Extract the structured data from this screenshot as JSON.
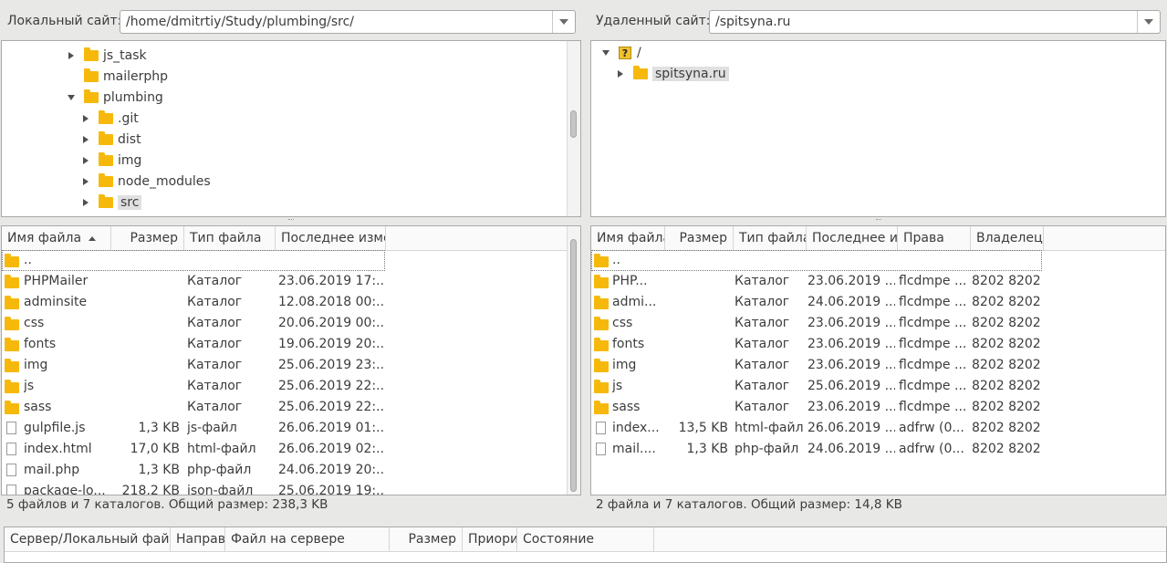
{
  "local_site": {
    "label": "Локальный сайт:",
    "path": "/home/dmitrtiy/Study/plumbing/src/"
  },
  "remote_site": {
    "label": "Удаленный сайт:",
    "path": "/spitsyna.ru"
  },
  "local_tree": [
    {
      "name": "js_task",
      "depth": 0,
      "expander": "collapsed"
    },
    {
      "name": "mailerphp",
      "depth": 0,
      "expander": "none"
    },
    {
      "name": "plumbing",
      "depth": 0,
      "expander": "expanded"
    },
    {
      "name": ".git",
      "depth": 1,
      "expander": "collapsed"
    },
    {
      "name": "dist",
      "depth": 1,
      "expander": "collapsed"
    },
    {
      "name": "img",
      "depth": 1,
      "expander": "collapsed"
    },
    {
      "name": "node_modules",
      "depth": 1,
      "expander": "collapsed"
    },
    {
      "name": "src",
      "depth": 1,
      "expander": "collapsed",
      "selected": true
    }
  ],
  "remote_tree": [
    {
      "name": "/",
      "icon": "question-folder-icon",
      "expander": "expanded"
    },
    {
      "name": "spitsyna.ru",
      "icon": "folder-icon",
      "expander": "collapsed",
      "selected": true
    }
  ],
  "local_list": {
    "headers": [
      "Имя файла",
      "Размер",
      "Тип файла",
      "Последнее изме"
    ],
    "rows": [
      {
        "icon": "folder-icon",
        "name": "..",
        "size": "",
        "type": "",
        "modified": ""
      },
      {
        "icon": "folder-icon",
        "name": "PHPMailer",
        "size": "",
        "type": "Каталог",
        "modified": "23.06.2019 17:..."
      },
      {
        "icon": "folder-icon",
        "name": "adminsite",
        "size": "",
        "type": "Каталог",
        "modified": "12.08.2018 00:..."
      },
      {
        "icon": "folder-icon",
        "name": "css",
        "size": "",
        "type": "Каталог",
        "modified": "20.06.2019 00:..."
      },
      {
        "icon": "folder-icon",
        "name": "fonts",
        "size": "",
        "type": "Каталог",
        "modified": "19.06.2019 20:..."
      },
      {
        "icon": "folder-icon",
        "name": "img",
        "size": "",
        "type": "Каталог",
        "modified": "25.06.2019 23:..."
      },
      {
        "icon": "folder-icon",
        "name": "js",
        "size": "",
        "type": "Каталог",
        "modified": "25.06.2019 22:..."
      },
      {
        "icon": "folder-icon",
        "name": "sass",
        "size": "",
        "type": "Каталог",
        "modified": "25.06.2019 22:..."
      },
      {
        "icon": "file-icon",
        "name": "gulpfile.js",
        "size": "1,3 KB",
        "type": "js-файл",
        "modified": "26.06.2019 01:..."
      },
      {
        "icon": "file-icon",
        "name": "index.html",
        "size": "17,0 KB",
        "type": "html-файл",
        "modified": "26.06.2019 02:..."
      },
      {
        "icon": "file-icon",
        "name": "mail.php",
        "size": "1,3 KB",
        "type": "php-файл",
        "modified": "24.06.2019 20:..."
      },
      {
        "icon": "file-icon",
        "name": "package-lo...",
        "size": "218,2 KB",
        "type": "json-файл",
        "modified": "25.06.2019 19:..."
      }
    ],
    "status": "5 файлов и 7 каталогов. Общий размер: 238,3 KB"
  },
  "remote_list": {
    "headers": [
      "Имя файла",
      "Размер",
      "Тип файла",
      "Последнее из",
      "Права",
      "Владелец/"
    ],
    "rows": [
      {
        "icon": "folder-icon",
        "name": "..",
        "size": "",
        "type": "",
        "modified": "",
        "perms": "",
        "owner": ""
      },
      {
        "icon": "folder-icon",
        "name": "PHP...",
        "size": "",
        "type": "Каталог",
        "modified": "23.06.2019 ...",
        "perms": "flcdmpe ...",
        "owner": "8202 8202"
      },
      {
        "icon": "folder-icon",
        "name": "admi...",
        "size": "",
        "type": "Каталог",
        "modified": "24.06.2019 ...",
        "perms": "flcdmpe ...",
        "owner": "8202 8202"
      },
      {
        "icon": "folder-icon",
        "name": "css",
        "size": "",
        "type": "Каталог",
        "modified": "23.06.2019 ...",
        "perms": "flcdmpe ...",
        "owner": "8202 8202"
      },
      {
        "icon": "folder-icon",
        "name": "fonts",
        "size": "",
        "type": "Каталог",
        "modified": "23.06.2019 ...",
        "perms": "flcdmpe ...",
        "owner": "8202 8202"
      },
      {
        "icon": "folder-icon",
        "name": "img",
        "size": "",
        "type": "Каталог",
        "modified": "23.06.2019 ...",
        "perms": "flcdmpe ...",
        "owner": "8202 8202"
      },
      {
        "icon": "folder-icon",
        "name": "js",
        "size": "",
        "type": "Каталог",
        "modified": "25.06.2019 ...",
        "perms": "flcdmpe ...",
        "owner": "8202 8202"
      },
      {
        "icon": "folder-icon",
        "name": "sass",
        "size": "",
        "type": "Каталог",
        "modified": "23.06.2019 ...",
        "perms": "flcdmpe ...",
        "owner": "8202 8202"
      },
      {
        "icon": "file-icon",
        "name": "index...",
        "size": "13,5 KB",
        "type": "html-файл",
        "modified": "26.06.2019 ...",
        "perms": "adfrw (0...",
        "owner": "8202 8202"
      },
      {
        "icon": "file-icon",
        "name": "mail....",
        "size": "1,3 KB",
        "type": "php-файл",
        "modified": "24.06.2019 ...",
        "perms": "adfrw (0...",
        "owner": "8202 8202"
      }
    ],
    "status": "2 файла и 7 каталогов. Общий размер: 14,8 KB"
  },
  "queue": {
    "headers": [
      "Сервер/Локальный файл",
      "Направл",
      "Файл на сервере",
      "Размер",
      "Приори",
      "Состояние"
    ]
  }
}
